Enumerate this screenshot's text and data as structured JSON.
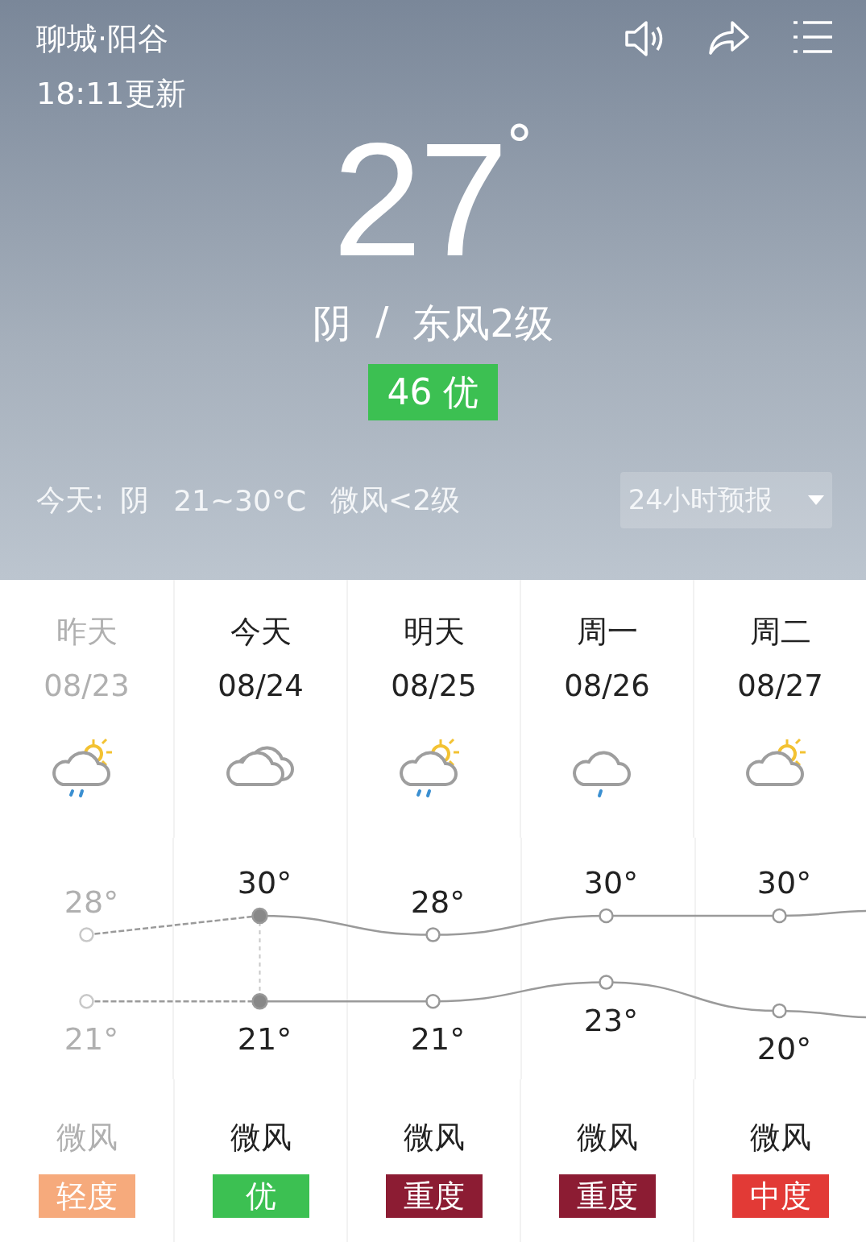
{
  "header": {
    "location": "聊城·阳谷",
    "updated": "18:11更新"
  },
  "current": {
    "temperature": "27",
    "degree": "°",
    "condition": "阴",
    "separator": "/",
    "wind": "东风2级",
    "aqi": {
      "text": "46 优",
      "color": "#3cc052"
    }
  },
  "today_summary": {
    "label": "今天:",
    "condition": "阴",
    "range": "21~30°C",
    "wind": "微风<2级"
  },
  "forecast_dropdown": {
    "label": "24小时预报"
  },
  "forecast": {
    "days": [
      {
        "name": "昨天",
        "past": true,
        "kind": "rain-sun",
        "wind": "微风",
        "aqi": "轻度",
        "color": "#f6aa7c"
      },
      {
        "name": "今天",
        "past": false,
        "kind": "cloudy",
        "wind": "微风",
        "aqi": "优",
        "color": "#3cc052"
      },
      {
        "name": "明天",
        "past": false,
        "kind": "rain-sun",
        "wind": "微风",
        "aqi": "重度",
        "color": "#8c1c33"
      },
      {
        "name": "周一",
        "past": false,
        "kind": "rain",
        "wind": "微风",
        "aqi": "重度",
        "color": "#8c1c33"
      },
      {
        "name": "周二",
        "past": false,
        "kind": "sun-cloud",
        "wind": "微风",
        "aqi": "中度",
        "color": "#e23a36"
      }
    ],
    "chart_data": {
      "type": "line",
      "categories": [
        "08/23",
        "08/24",
        "08/25",
        "08/26",
        "08/27"
      ],
      "series": [
        {
          "color": "#9a9a9a",
          "marker": "circle",
          "values": [
            28,
            30,
            28,
            30,
            30
          ],
          "value_labels": [
            "28°",
            "30°",
            "28°",
            "30°",
            "30°"
          ]
        },
        {
          "color": "#9a9a9a",
          "marker": "circle",
          "values": [
            21,
            21,
            21,
            23,
            20
          ],
          "value_labels": [
            "21°",
            "21°",
            "21°",
            "23°",
            "20°"
          ]
        }
      ]
    }
  }
}
